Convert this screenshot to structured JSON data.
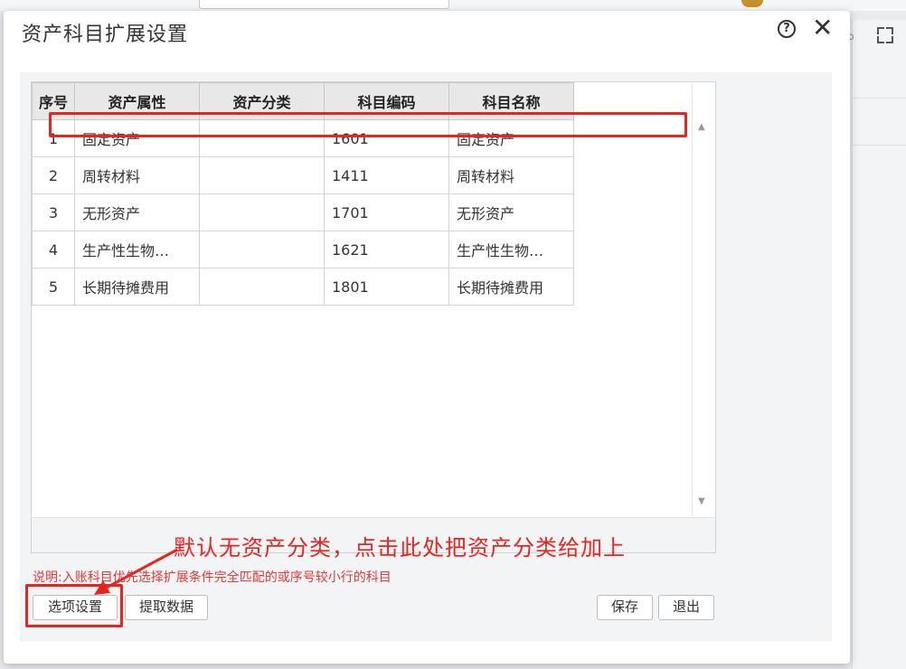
{
  "dialog": {
    "title": "资产科目扩展设置",
    "help_icon": "?",
    "close_icon": "✕"
  },
  "grid": {
    "columns": [
      "序号",
      "资产属性",
      "资产分类",
      "科目编码",
      "科目名称"
    ],
    "rows": [
      {
        "seq": "1",
        "attr": "固定资产",
        "category": "",
        "code": "1601",
        "name": "固定资产"
      },
      {
        "seq": "2",
        "attr": "周转材料",
        "category": "",
        "code": "1411",
        "name": "周转材料"
      },
      {
        "seq": "3",
        "attr": "无形资产",
        "category": "",
        "code": "1701",
        "name": "无形资产"
      },
      {
        "seq": "4",
        "attr": "生产性生物…",
        "category": "",
        "code": "1621",
        "name": "生产性生物…"
      },
      {
        "seq": "5",
        "attr": "长期待摊费用",
        "category": "",
        "code": "1801",
        "name": "长期待摊费用"
      }
    ]
  },
  "note": "说明:入账科目优先选择扩展条件完全匹配的或序号较小行的科目",
  "buttons": {
    "options": "选项设置",
    "fetch": "提取数据",
    "save": "保存",
    "exit": "退出"
  },
  "annotation": {
    "text": "默认无资产分类，点击此处把资产分类给加上",
    "color": "#e5251f"
  }
}
